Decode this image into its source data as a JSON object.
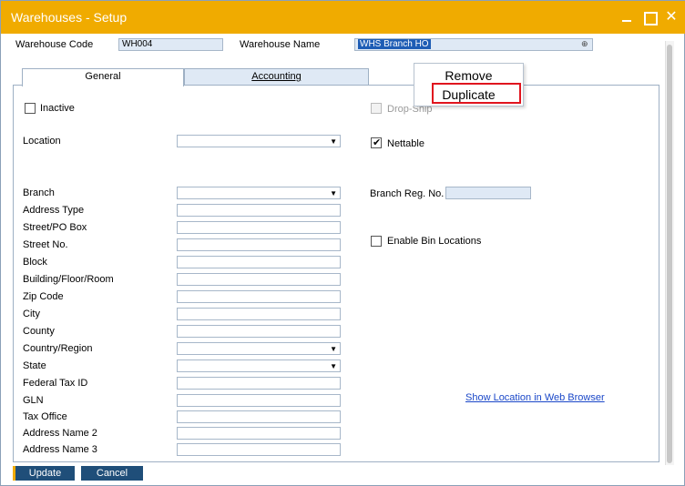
{
  "window": {
    "title": "Warehouses - Setup"
  },
  "header": {
    "warehouse_code_label": "Warehouse Code",
    "warehouse_code_value": "WH004",
    "warehouse_name_label": "Warehouse Name",
    "warehouse_name_value": "WHS Branch HO"
  },
  "tabs": [
    {
      "label": "General",
      "active": true
    },
    {
      "label": "Accounting",
      "active": false
    }
  ],
  "context_menu": {
    "items": [
      "Remove",
      "Duplicate"
    ],
    "highlighted": "Duplicate"
  },
  "general": {
    "inactive_label": "Inactive",
    "drop_ship_label": "Drop-Ship",
    "nettable_label": "Nettable",
    "nettable_checked": true,
    "location_label": "Location",
    "branch_label": "Branch",
    "branch_reg_label": "Branch Reg. No.",
    "enable_bin_label": "Enable Bin Locations",
    "address_labels": [
      "Address Type",
      "Street/PO Box",
      "Street No.",
      "Block",
      "Building/Floor/Room",
      "Zip Code",
      "City",
      "County",
      "Country/Region",
      "State",
      "Federal Tax ID",
      "GLN",
      "Tax Office",
      "Address Name 2",
      "Address Name 3"
    ],
    "show_location_link": "Show Location in Web Browser"
  },
  "footer": {
    "update_label": "Update",
    "cancel_label": "Cancel"
  },
  "colors": {
    "title_bar": "#f0ab00",
    "button": "#1f4e79",
    "highlight_box": "#e0141e",
    "link": "#1a47c8"
  }
}
